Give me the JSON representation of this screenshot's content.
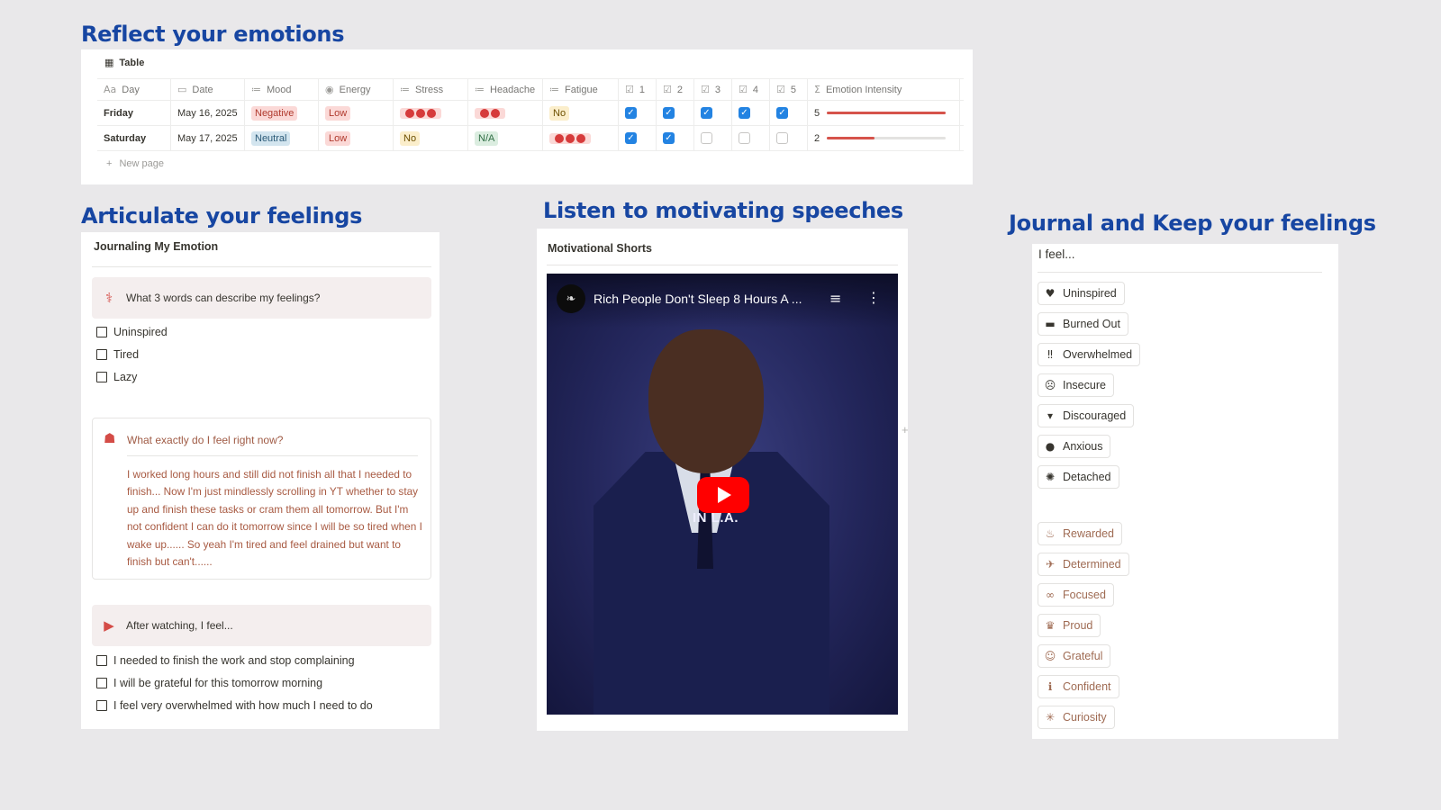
{
  "headings": {
    "reflect": "Reflect your emotions",
    "articulate": "Articulate your feelings",
    "listen": "Listen to motivating speeches",
    "journal": "Journal and Keep your feelings"
  },
  "table": {
    "view_label": "Table",
    "columns": [
      {
        "icon": "Aa",
        "label": "Day"
      },
      {
        "icon": "▭",
        "label": "Date"
      },
      {
        "icon": "≔",
        "label": "Mood"
      },
      {
        "icon": "◉",
        "label": "Energy"
      },
      {
        "icon": "≔",
        "label": "Stress"
      },
      {
        "icon": "≔",
        "label": "Headache"
      },
      {
        "icon": "≔",
        "label": "Fatigue"
      },
      {
        "icon": "☑",
        "label": "1"
      },
      {
        "icon": "☑",
        "label": "2"
      },
      {
        "icon": "☑",
        "label": "3"
      },
      {
        "icon": "☑",
        "label": "4"
      },
      {
        "icon": "☑",
        "label": "5"
      },
      {
        "icon": "Σ",
        "label": "Emotion Intensity"
      }
    ],
    "rows": [
      {
        "day": "Friday",
        "date": "May 16, 2025",
        "mood": "Negative",
        "energy": "Low",
        "stress_dots": 3,
        "headache_dots": 2,
        "fatigue": "No",
        "checks": [
          true,
          true,
          true,
          true,
          true
        ],
        "intensity": "5",
        "intensity_fraction": 1.0
      },
      {
        "day": "Saturday",
        "date": "May 17, 2025",
        "mood": "Neutral",
        "energy": "Low",
        "stress": "No",
        "headache": "N/A",
        "fatigue_dots": 3,
        "checks": [
          true,
          true,
          false,
          false,
          false
        ],
        "intensity": "2",
        "intensity_fraction": 0.4
      }
    ],
    "new_page_label": "New page"
  },
  "journal": {
    "title": "Journaling My Emotion",
    "q1": "What 3 words can describe my feelings?",
    "words": [
      "Uninspired",
      "Tired",
      "Lazy"
    ],
    "q2": "What exactly do I feel right now?",
    "answer": "I worked long hours and still did not finish all that I needed to finish... Now I'm just mindlessly scrolling in YT whether to stay up and finish these tasks or cram them all tomorrow. But I'm not confident I can do it tomorrow since I will be so tired when I wake up...... So yeah I'm tired and feel drained but want to finish but can't......",
    "q3": "After watching, I feel...",
    "after": [
      "I needed to finish the work and stop complaining",
      "I will be grateful for this tomorrow morning",
      "I feel very overwhelmed with how much I need to do"
    ]
  },
  "video": {
    "card_title": "Motivational Shorts",
    "title": "Rich People Don't Sleep 8 Hours A ...",
    "caption": "IN L.A."
  },
  "feelings": {
    "title": "I feel...",
    "negative": [
      {
        "icon": "heart-broken-icon",
        "glyph": "♥",
        "label": "Uninspired"
      },
      {
        "icon": "battery-low-icon",
        "glyph": "▬",
        "label": "Burned Out"
      },
      {
        "icon": "exclamation-icon",
        "glyph": "‼",
        "label": "Overwhelmed"
      },
      {
        "icon": "mask-icon",
        "glyph": "☹",
        "label": "Insecure"
      },
      {
        "icon": "thumbs-down-icon",
        "glyph": "▾",
        "label": "Discouraged"
      },
      {
        "icon": "bomb-icon",
        "glyph": "●",
        "label": "Anxious"
      },
      {
        "icon": "detached-icon",
        "glyph": "✺",
        "label": "Detached"
      }
    ],
    "positive": [
      {
        "icon": "cake-icon",
        "glyph": "♨",
        "label": "Rewarded"
      },
      {
        "icon": "running-icon",
        "glyph": "✈",
        "label": "Determined"
      },
      {
        "icon": "glasses-icon",
        "glyph": "∞",
        "label": "Focused"
      },
      {
        "icon": "trophy-icon",
        "glyph": "♛",
        "label": "Proud"
      },
      {
        "icon": "smile-icon",
        "glyph": "☺",
        "label": "Grateful"
      },
      {
        "icon": "info-icon",
        "glyph": "ℹ",
        "label": "Confident"
      },
      {
        "icon": "sparkle-icon",
        "glyph": "✳",
        "label": "Curiosity"
      }
    ]
  }
}
